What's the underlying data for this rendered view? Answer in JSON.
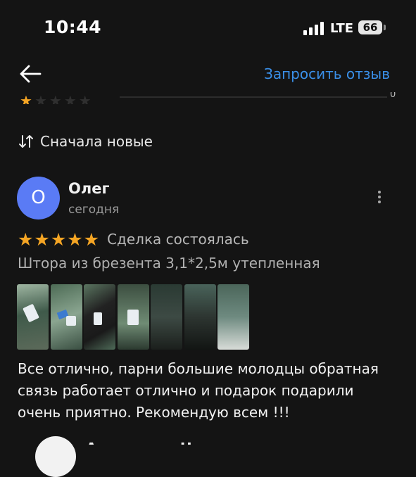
{
  "status_bar": {
    "time": "10:44",
    "network": "LTE",
    "battery": "66"
  },
  "app_bar": {
    "back_icon": "arrow-left-icon",
    "request_review": "Запросить отзыв"
  },
  "rating_histogram_row": {
    "stars_filled": 1,
    "stars_total": 5,
    "count": "0"
  },
  "sort": {
    "icon": "sort-arrows-icon",
    "label": "Сначала новые"
  },
  "review": {
    "avatar_letter": "О",
    "avatar_color": "#5a7bf5",
    "author": "Олег",
    "date": "сегодня",
    "rating": 5,
    "stars": "★★★★★",
    "deal_status": "Сделка состоялась",
    "product": "Штора из брезента 3,1*2,5м утепленная",
    "photo_count": 7,
    "text": "Все отлично, парни большие молодцы  обратная связь работает отлично и подарок подарили очень приятно. Рекомендую всем !!!"
  },
  "next_review": {
    "author": "Александр Н."
  },
  "colors": {
    "background": "#141414",
    "accent": "#3a8fe8",
    "star": "#f5a524"
  }
}
